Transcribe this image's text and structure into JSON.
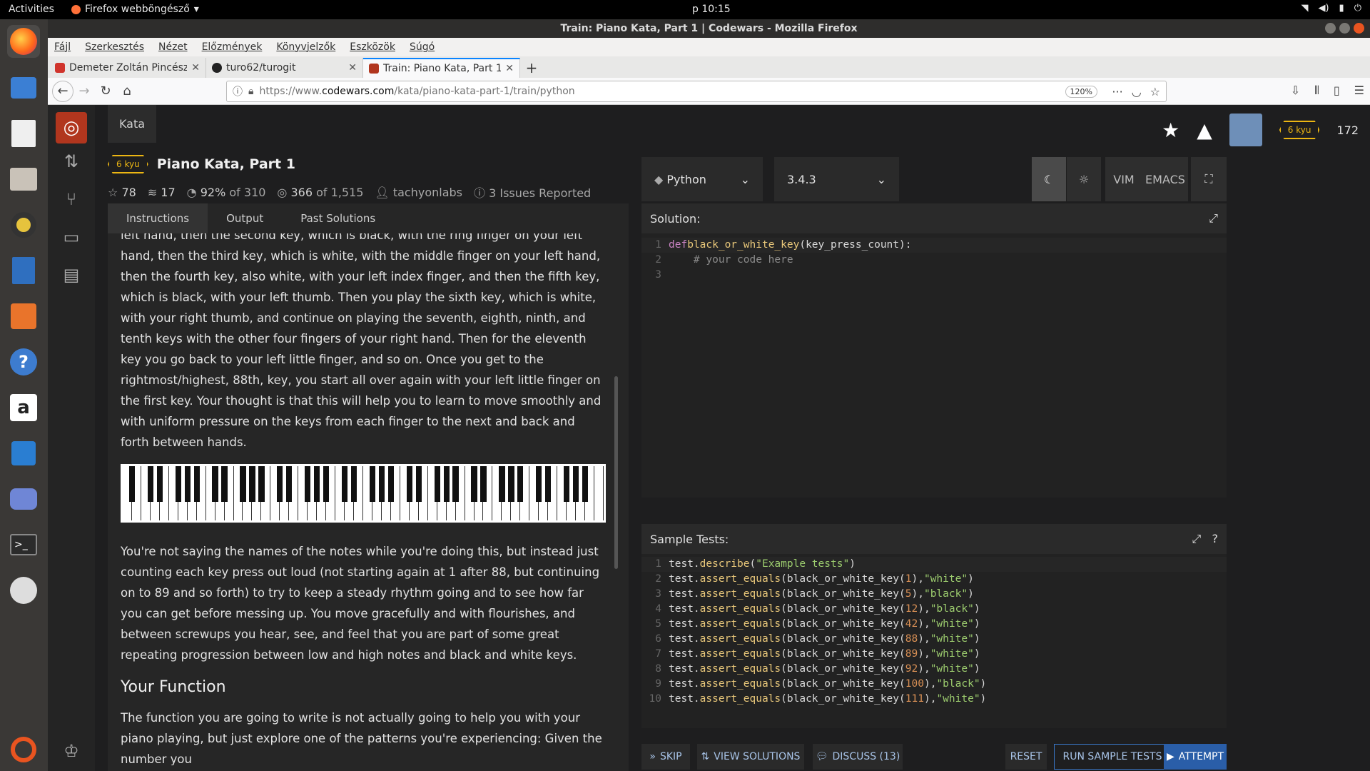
{
  "topbar": {
    "activities": "Activities",
    "app_name": "Firefox webböngésző",
    "clock": "p 10:15"
  },
  "window": {
    "title": "Train: Piano Kata, Part 1 | Codewars - Mozilla Firefox"
  },
  "menu": [
    "Fájl",
    "Szerkesztés",
    "Nézet",
    "Előzmények",
    "Könyvjelzők",
    "Eszközök",
    "Súgó"
  ],
  "tabs": [
    {
      "label": "Demeter Zoltán Pincésze",
      "color": "#d0342c"
    },
    {
      "label": "turo62/turogit",
      "color": "#222222"
    },
    {
      "label": "Train: Piano Kata, Part 1",
      "color": "#b1361e"
    }
  ],
  "url": {
    "prefix": "https://www.",
    "domain": "codewars.com",
    "path": "/kata/piano-kata-part-1/train/python",
    "zoom": "120%"
  },
  "site": {
    "kata_button": "Kata",
    "rank_badge": "6 kyu",
    "honor": "172"
  },
  "kata": {
    "rank": "6 kyu",
    "title": "Piano Kata, Part 1",
    "stars": "78",
    "collections": "17",
    "satisfaction": "92%",
    "satisfaction_of": "of 310",
    "completed": "366",
    "completed_of": "of 1,515",
    "author": "tachyonlabs",
    "issues": "3 Issues Reported"
  },
  "desc_tabs": [
    "Instructions",
    "Output",
    "Past Solutions"
  ],
  "description": {
    "p1": "left hand, then the second key, which is black, with the ring finger on your left hand, then the third key, which is white, with the middle finger on your left hand, then the fourth key, also white, with your left index finger, and then the fifth key, which is black, with your left thumb. Then you play the sixth key, which is white, with your right thumb, and continue on playing the seventh, eighth, ninth, and tenth keys with the other four fingers of your right hand. Then for the eleventh key you go back to your left little finger, and so on. Once you get to the rightmost/highest, 88th, key, you start all over again with your left little finger on the first key. Your thought is that this will help you to learn to move smoothly and with uniform pressure on the keys from each finger to the next and back and forth between hands.",
    "p2": "You're not saying the names of the notes while you're doing this, but instead just counting each key press out loud (not starting again at 1 after 88, but continuing on to 89 and so forth) to try to keep a steady rhythm going and to see how far you can get before messing up. You move gracefully and with flourishes, and between screwups you hear, see, and feel that you are part of some great repeating progression between low and high notes and black and white keys.",
    "h2": "Your Function",
    "p3": "The function you are going to write is not actually going to help you with your piano playing, but just explore one of the patterns you're experiencing: Given the number you"
  },
  "language": "Python",
  "version": "3.4.3",
  "modes": {
    "vim": "VIM",
    "emacs": "EMACS"
  },
  "solution": {
    "heading": "Solution:",
    "lines": [
      {
        "n": "1",
        "kw": "def ",
        "fn": "black_or_white_key",
        "rest": "(key_press_count):"
      },
      {
        "n": "2",
        "comment": "    # your code here"
      },
      {
        "n": "3"
      }
    ]
  },
  "tests": {
    "heading": "Sample Tests:",
    "describe": "\"Example tests\"",
    "cases": [
      {
        "n": "2",
        "arg": "1",
        "res": "\"white\""
      },
      {
        "n": "3",
        "arg": "5",
        "res": "\"black\""
      },
      {
        "n": "4",
        "arg": "12",
        "res": "\"black\""
      },
      {
        "n": "5",
        "arg": "42",
        "res": "\"white\""
      },
      {
        "n": "6",
        "arg": "88",
        "res": "\"white\""
      },
      {
        "n": "7",
        "arg": "89",
        "res": "\"white\""
      },
      {
        "n": "8",
        "arg": "92",
        "res": "\"white\""
      },
      {
        "n": "9",
        "arg": "100",
        "res": "\"black\""
      },
      {
        "n": "10",
        "arg": "111",
        "res": "\"white\""
      }
    ]
  },
  "actions": {
    "skip": "SKIP",
    "view_solutions": "VIEW SOLUTIONS",
    "discuss": "DISCUSS (13)",
    "reset": "RESET",
    "run": "RUN SAMPLE TESTS",
    "attempt": "ATTEMPT"
  }
}
